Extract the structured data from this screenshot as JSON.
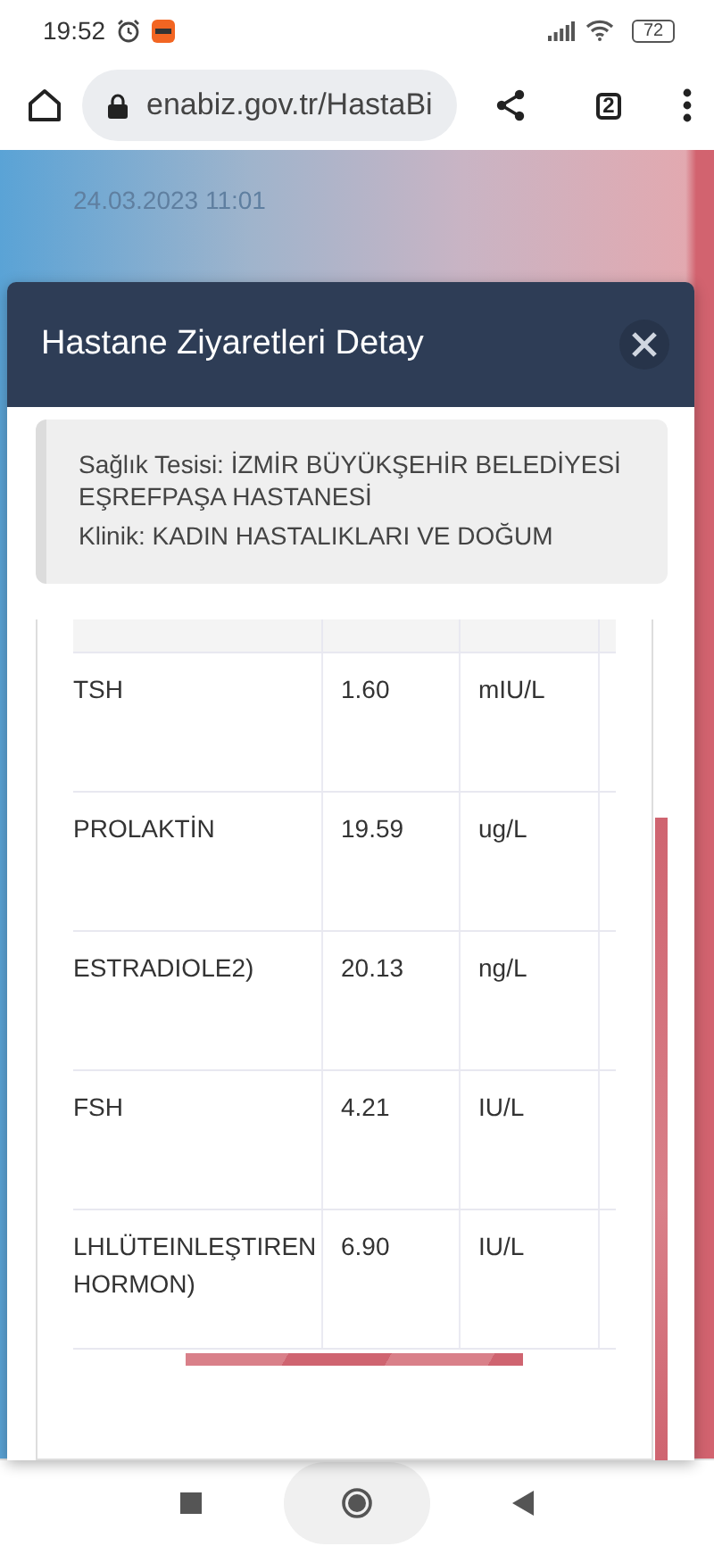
{
  "status_bar": {
    "time": "19:52",
    "battery": "72"
  },
  "browser": {
    "url": "enabiz.gov.tr/HastaBi",
    "tab_count": "2"
  },
  "page": {
    "date": "24.03.2023 11:01"
  },
  "dialog": {
    "title": "Hastane Ziyaretleri Detay",
    "info": [
      "Sağlık Tesisi: İZMİR BÜYÜKŞEHİR BELEDİYESİ EŞREFPAŞA HASTANESİ",
      "Klinik: KADIN HASTALIKLARI VE DOĞUM"
    ],
    "rows": [
      {
        "name": "TSH",
        "result": "1.60",
        "unit": "mIU/L"
      },
      {
        "name": "PROLAKTİN",
        "result": "19.59",
        "unit": "ug/L"
      },
      {
        "name": "ESTRADIOLE2)",
        "result": "20.13",
        "unit": "ng/L"
      },
      {
        "name": "FSH",
        "result": "4.21",
        "unit": "IU/L"
      },
      {
        "name": "LHLÜTEINLEŞTIREN HORMON)",
        "result": "6.90",
        "unit": "IU/L"
      }
    ]
  }
}
